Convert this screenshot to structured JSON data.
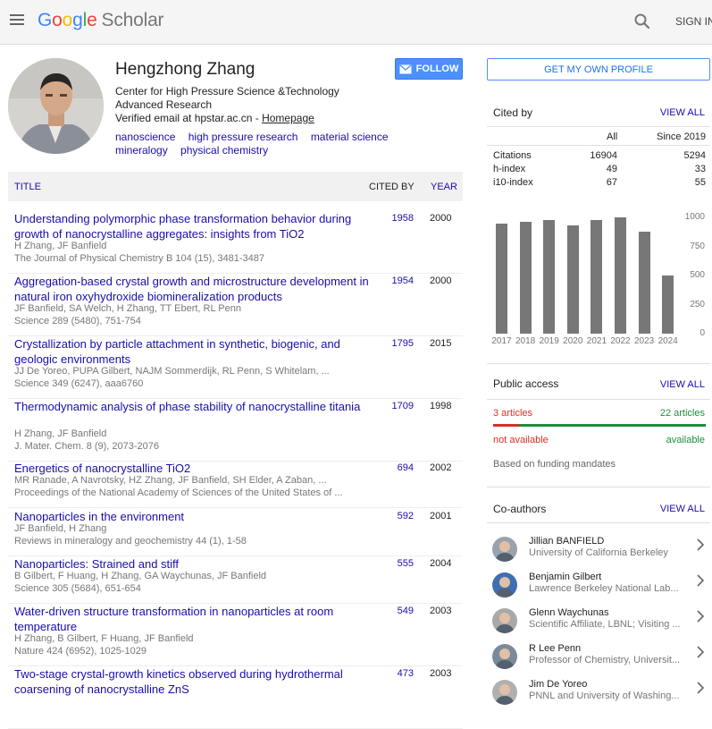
{
  "header": {
    "logo_letters": [
      "G",
      "o",
      "o",
      "g",
      "l",
      "e"
    ],
    "logo_product": "Scholar",
    "signin_label": "SIGN IN",
    "menu_icon": "menu-icon",
    "search_icon": "search-icon"
  },
  "profile": {
    "name": "Hengzhong Zhang",
    "affiliation": "Center for High Pressure Science &Technology Advanced Research",
    "email_text": "Verified email at hpstar.ac.cn - ",
    "homepage_label": "Homepage",
    "follow_label": "FOLLOW",
    "interests": [
      "nanoscience",
      "high pressure research",
      "material science",
      "mineralogy",
      "physical chemistry"
    ]
  },
  "table": {
    "headers": {
      "title": "TITLE",
      "cited_by": "CITED BY",
      "year": "YEAR"
    },
    "rows": [
      {
        "title": "Understanding polymorphic phase transformation behavior during growth of nanocrystalline aggregates: insights from TiO2",
        "authors": "H Zhang, JF Banfield",
        "venue": "The Journal of Physical Chemistry B 104 (15), 3481-3487",
        "cited": "1958",
        "year": "2000"
      },
      {
        "title": "Aggregation-based crystal growth and microstructure development in natural iron oxyhydroxide biomineralization products",
        "authors": "JF Banfield, SA Welch, H Zhang, TT Ebert, RL Penn",
        "venue": "Science 289 (5480), 751-754",
        "cited": "1954",
        "year": "2000"
      },
      {
        "title": "Crystallization by particle attachment in synthetic, biogenic, and geologic environments",
        "authors": "JJ De Yoreo, PUPA Gilbert, NAJM Sommerdijk, RL Penn, S Whitelam, ...",
        "venue": "Science 349 (6247), aaa6760",
        "cited": "1795",
        "year": "2015"
      },
      {
        "title": "Thermodynamic analysis of phase stability of nanocrystalline titania",
        "authors": "H Zhang, JF Banfield",
        "venue": "J. Mater. Chem. 8 (9), 2073-2076",
        "cited": "1709",
        "year": "1998"
      },
      {
        "title": "Energetics of nanocrystalline TiO2",
        "authors": "MR Ranade, A Navrotsky, HZ Zhang, JF Banfield, SH Elder, A Zaban, ...",
        "venue": "Proceedings of the National Academy of Sciences of the United States of ...",
        "cited": "694",
        "year": "2002"
      },
      {
        "title": "Nanoparticles in the environment",
        "authors": "JF Banfield, H Zhang",
        "venue": "Reviews in mineralogy and geochemistry 44 (1), 1-58",
        "cited": "592",
        "year": "2001"
      },
      {
        "title": "Nanoparticles: Strained and stiff",
        "authors": "B Gilbert, F Huang, H Zhang, GA Waychunas, JF Banfield",
        "venue": "Science 305 (5684), 651-654",
        "cited": "555",
        "year": "2004"
      },
      {
        "title": "Water-driven structure transformation in nanoparticles at room temperature",
        "authors": "H Zhang, B Gilbert, F Huang, JF Banfield",
        "venue": "Nature 424 (6952), 1025-1029",
        "cited": "549",
        "year": "2003"
      },
      {
        "title": "Two-stage crystal-growth kinetics observed during hydrothermal coarsening of nanocrystalline ZnS",
        "authors": "",
        "venue": "",
        "cited": "473",
        "year": "2003"
      }
    ]
  },
  "sidebar": {
    "get_profile_label": "GET MY OWN PROFILE",
    "cited_by": {
      "title": "Cited by",
      "view_all": "VIEW ALL",
      "col_all": "All",
      "col_since": "Since 2019",
      "rows": [
        {
          "label": "Citations",
          "all": "16904",
          "since": "5294"
        },
        {
          "label": "h-index",
          "all": "49",
          "since": "33"
        },
        {
          "label": "i10-index",
          "all": "67",
          "since": "55"
        }
      ]
    },
    "public_access": {
      "title": "Public access",
      "view_all": "VIEW ALL",
      "not_available_count": "3 articles",
      "available_count": "22 articles",
      "not_available_label": "not available",
      "available_label": "available",
      "available_fraction": 0.88,
      "mandates": "Based on funding mandates"
    },
    "coauthors": {
      "title": "Co-authors",
      "view_all": "VIEW ALL",
      "items": [
        {
          "name": "Jillian BANFIELD",
          "affil": "University of California Berkeley"
        },
        {
          "name": "Benjamin Gilbert",
          "affil": "Lawrence Berkeley National Lab..."
        },
        {
          "name": "Glenn Waychunas",
          "affil": "Scientific Affiliate, LBNL; Visiting ..."
        },
        {
          "name": "R Lee Penn",
          "affil": "Professor of Chemistry, Universit..."
        },
        {
          "name": "Jim De Yoreo",
          "affil": "PNNL and University of Washing..."
        }
      ]
    }
  },
  "chart_data": {
    "type": "bar",
    "categories": [
      "2017",
      "2018",
      "2019",
      "2020",
      "2021",
      "2022",
      "2023",
      "2024"
    ],
    "values": [
      950,
      960,
      975,
      930,
      980,
      1000,
      880,
      500
    ],
    "yticks": [
      "1000",
      "750",
      "500",
      "250",
      "0"
    ],
    "ylim": [
      0,
      1000
    ],
    "bar_color": "#777777"
  },
  "colors": {
    "link": "#1a0dab",
    "accent": "#4d90fe",
    "red": "#d93025",
    "green": "#1e8e3e"
  }
}
